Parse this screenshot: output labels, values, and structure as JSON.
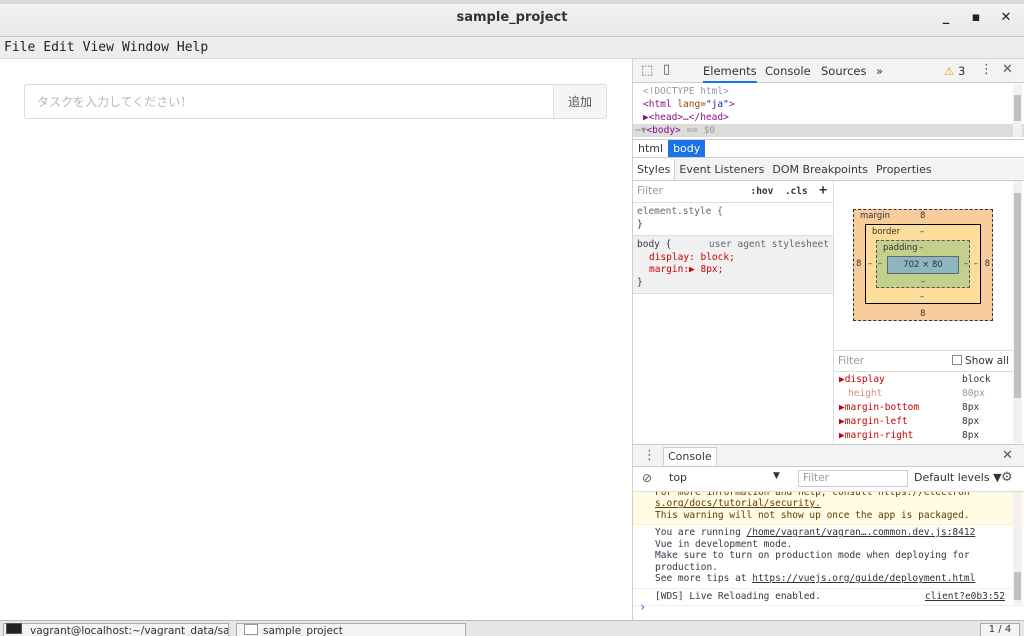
{
  "window": {
    "title": "sample_project",
    "minimize": "_",
    "maximize": "▪",
    "close": "✕"
  },
  "menu": {
    "items": [
      "File",
      "Edit",
      "View",
      "Window",
      "Help"
    ]
  },
  "app": {
    "placeholder": "タスクを入力してください！",
    "add_label": "追加"
  },
  "devtools": {
    "tabs": {
      "elements": "Elements",
      "console": "Console",
      "sources": "Sources",
      "more": "»"
    },
    "warnings": "3",
    "dom": {
      "doctype": "<!DOCTYPE html>",
      "html_tag": "<html",
      "html_attr": " lang=",
      "html_val": "\"ja\"",
      "html_close": ">",
      "head": "▶<head>…</head>",
      "body_prefix": "⋯▼",
      "body_tag": "<body>",
      "body_suffix": " == $0"
    },
    "breadcrumbs": [
      "html",
      "body"
    ],
    "subtabs": [
      "Styles",
      "Event Listeners",
      "DOM Breakpoints",
      "Properties"
    ],
    "styles": {
      "filter": "Filter",
      "hov": ":hov",
      "cls": ".cls",
      "plus": "+",
      "element_style": "element.style {",
      "close": "}",
      "body_selector": "body {",
      "ua_label": "user agent stylesheet",
      "display": "display: block;",
      "margin": "margin:▶ 8px;"
    },
    "box_model": {
      "margin_label": "margin",
      "margin_val": "8",
      "border_label": "border",
      "border_val": "–",
      "padding_label": "padding",
      "padding_val": "–",
      "content": "702 × 80",
      "side_val": "8",
      "dash": "–"
    },
    "computed": {
      "filter": "Filter",
      "show_all": "Show all",
      "rows": [
        {
          "name": "▶display",
          "value": "block"
        },
        {
          "name": "height",
          "value": "80px"
        },
        {
          "name": "▶margin-bottom",
          "value": "8px"
        },
        {
          "name": "▶margin-left",
          "value": "8px"
        },
        {
          "name": "▶margin-right",
          "value": "8px"
        }
      ]
    },
    "console": {
      "tab": "Console",
      "context": "top",
      "filter": "Filter",
      "levels": "Default levels ▼",
      "warn_line1": "For more information and help, consult https://electron",
      "warn_line2": "s.org/docs/tutorial/security.",
      "warn_line3": "This warning will not show up once the app is packaged.",
      "vue_line1_prefix": "You are running ",
      "vue_line1_link": "/home/vagrant/vagran….common.dev.js:8412",
      "vue_line2": "Vue in development mode.",
      "vue_line3": "Make sure to turn on production mode when deploying for",
      "vue_line4": "production.",
      "vue_line5_prefix": "See more tips at ",
      "vue_line5_link": "https://vuejs.org/guide/deployment.html",
      "wds_text": "[WDS] Live Reloading enabled.",
      "wds_src": "client?e0b3:52",
      "prompt": "›"
    }
  },
  "taskbar": {
    "term_label": "vagrant@localhost:~/vagrant_data/sa...",
    "app_label": "sample_project",
    "workspace": "1 / 4"
  },
  "colors": {
    "accent": "#1a73e8",
    "warning": "#e8a300"
  }
}
